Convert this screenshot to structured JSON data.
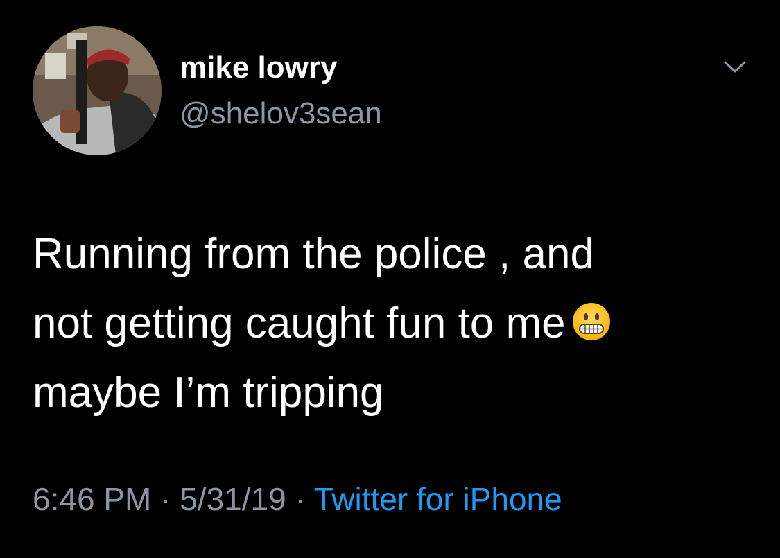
{
  "tweet": {
    "author": {
      "display_name": "mike lowry",
      "handle": "@shelov3sean",
      "avatar_icon": "profile-photo"
    },
    "more_icon": "chevron-down-icon",
    "text_lines": [
      "Running from the police , and",
      "not getting caught fun to me",
      "maybe I’m tripping"
    ],
    "emoji": "grimacing-face-emoji",
    "meta": {
      "time": "6:46 PM",
      "separator_1": " · ",
      "date": "5/31/19",
      "separator_2": " · ",
      "source": "Twitter for iPhone"
    }
  },
  "colors": {
    "background": "#000000",
    "text_primary": "#ffffff",
    "text_secondary": "#8a96a3",
    "link": "#1d9bf0",
    "divider": "#2f3336"
  }
}
